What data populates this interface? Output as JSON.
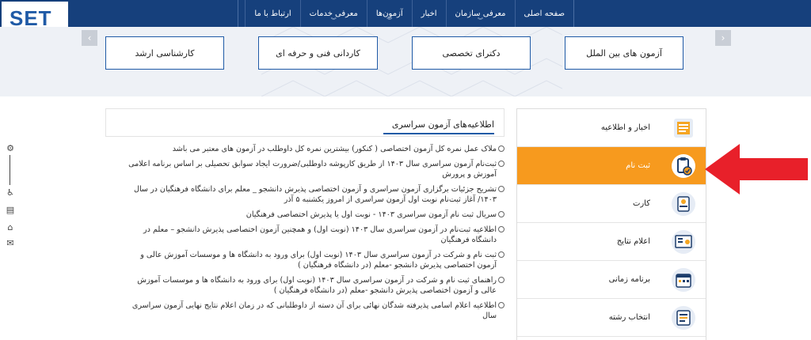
{
  "logo": {
    "text": "SET"
  },
  "nav": {
    "items": [
      {
        "label": "صفحه اصلی",
        "has_dropdown": false
      },
      {
        "label": "معرفی سازمان",
        "has_dropdown": true
      },
      {
        "label": "اخبار",
        "has_dropdown": false
      },
      {
        "label": "آزمون‌ها",
        "has_dropdown": true
      },
      {
        "label": "معرفی خدمات",
        "has_dropdown": true
      },
      {
        "label": "ارتباط با ما",
        "has_dropdown": false
      }
    ],
    "caret_glyph": "︾"
  },
  "categories": [
    {
      "label": "آزمون های بین الملل"
    },
    {
      "label": "دکترای تخصصی"
    },
    {
      "label": "کاردانی فنی و حرفه ای"
    },
    {
      "label": "کارشناسی ارشد"
    }
  ],
  "arrows": {
    "prev": "‹",
    "next": "›"
  },
  "news": {
    "title": "اطلاعیه‌های آزمون سراسری",
    "items": [
      "ملاک عمل نمره کل آزمون اختصاصی ( کنکور) بیشترین نمره کل داوطلب در آزمون های معتبر می باشد",
      "ثبت‌نام آزمون سراسری سال ۱۴۰۳ از طریق کارپوشه داوطلبی/ضرورت ایجاد سوابق تحصیلی بر اساس برنامه اعلامی آموزش و پرورش",
      "تشریح جزئیات برگزاری آزمون سراسری و آزمون اختصاصی پذیرش دانشجو _ معلم برای دانشگاه فرهنگیان در سال ۱۴۰۳/ آغاز ثبت‌نام نوبت اول آزمون سراسری از امروز یکشنبه ۵ آذر",
      "سریال ثبت نام آزمون سراسری ۱۴۰۳ - نوبت اول یا پذیرش اختصاصی فرهنگیان",
      "اطلاعیه ثبت‌نام در آزمون سراسری  سال ۱۴۰۳ (نوبت اول) و همچنین آزمون اختصاصی پذیرش دانشجو – معلم در دانشگاه فرهنگیان",
      "ثبت نام و شرکت در آزمون سراسری سال ۱۴۰۳ (نوبت اول) برای ورود به دانشگاه ها و موسسات آموزش عالی و آزمون اختصاصی پذیرش دانشجو -معلم (در دانشگاه فرهنگیان )",
      "راهنمای ثبت نام و شرکت در آزمون سراسری سال ۱۴۰۳ (نوبت اول) برای ورود به دانشگاه ها و موسسات آموزش عالی و آزمون اختصاصی پذیرش دانشجو -معلم (در دانشگاه فرهنگیان )",
      "اطلاعیه اعلام اسامی پذیرفته شدگان نهائی برای آن دسته از داوطلبانی که در زمان اعلام نتایج نهایی آزمون سراسری سال"
    ]
  },
  "sidebar": {
    "items": [
      {
        "label": "اخبار و اطلاعیه",
        "icon": "newspaper-icon",
        "active": false
      },
      {
        "label": "ثبت نام",
        "icon": "clipboard-check-icon",
        "active": true
      },
      {
        "label": "کارت",
        "icon": "id-card-icon",
        "active": false
      },
      {
        "label": "اعلام نتایج",
        "icon": "results-board-icon",
        "active": false
      },
      {
        "label": "برنامه زمانی",
        "icon": "calendar-icon",
        "active": false
      },
      {
        "label": "انتخاب رشته",
        "icon": "choose-field-icon",
        "active": false
      }
    ],
    "active_color": "#f79a1e"
  },
  "tools": [
    {
      "icon": "gear-icon",
      "glyph": "⚙"
    },
    {
      "icon": "accessibility-icon",
      "glyph": "♿"
    },
    {
      "icon": "document-icon",
      "glyph": "▤"
    },
    {
      "icon": "building-icon",
      "glyph": "⌂"
    },
    {
      "icon": "chat-icon",
      "glyph": "✉"
    }
  ],
  "colors": {
    "navbar": "#16407c",
    "brand": "#1f5aa6",
    "accent": "#f79a1e",
    "pointer": "#e8202a"
  }
}
